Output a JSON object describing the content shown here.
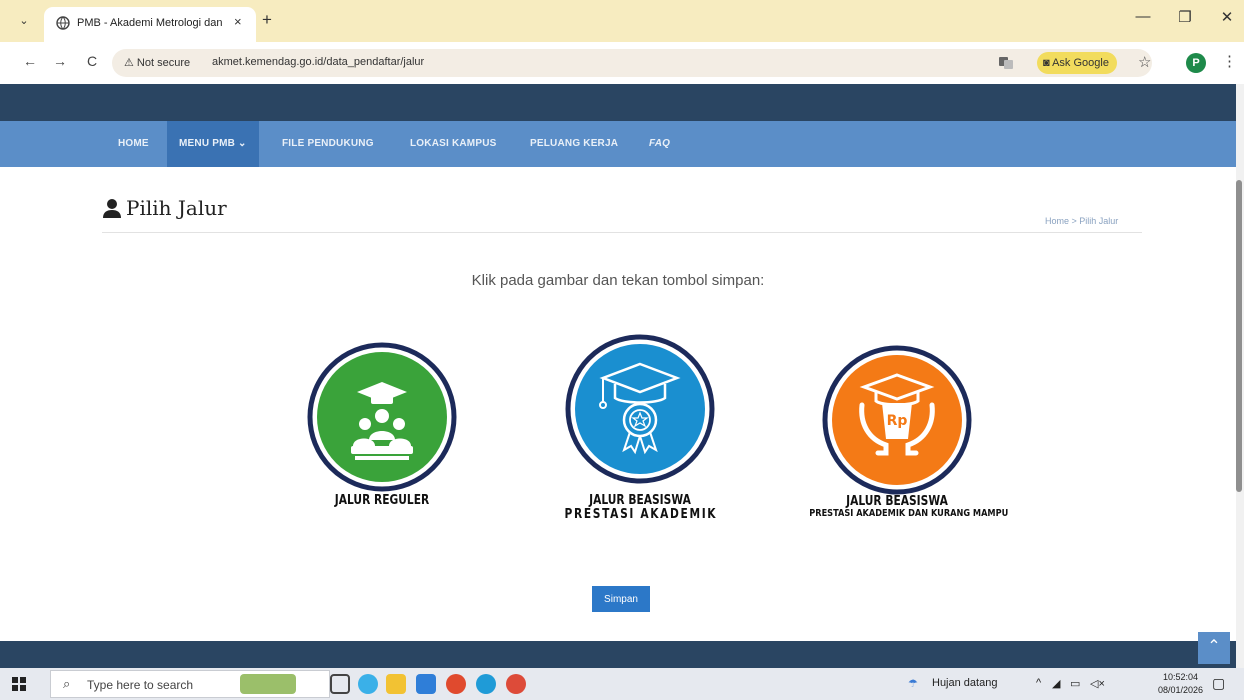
{
  "browser": {
    "tab_title": "PMB - Akademi Metrologi dan",
    "tab_close": "×",
    "new_tab": "+",
    "tab_menu": "⌄",
    "minimize": "—",
    "restore": "❐",
    "close": "✕",
    "back": "←",
    "forward": "→",
    "reload": "C",
    "security_label": "Not secure",
    "url": "akmet.kemendag.go.id/data_pendaftar/jalur",
    "ask_google": "Ask Google",
    "star": "☆",
    "profile_initial": "P",
    "menu": "⋮"
  },
  "nav": {
    "items": [
      {
        "label": "HOME"
      },
      {
        "label": "MENU PMB ⌄"
      },
      {
        "label": "FILE PENDUKUNG"
      },
      {
        "label": "LOKASI KAMPUS"
      },
      {
        "label": "PELUANG KERJA"
      },
      {
        "label": "FAQ"
      }
    ]
  },
  "page": {
    "title": "Pilih Jalur",
    "breadcrumb": "Home > Pilih Jalur",
    "instruction": "Klik pada gambar dan tekan tombol simpan:",
    "options": [
      {
        "line1": "JALUR REGULER",
        "line2": "",
        "color": "#3aa33a"
      },
      {
        "line1": "JALUR BEASISWA",
        "line2": "PRESTASI AKADEMIK",
        "color": "#1a8fd0"
      },
      {
        "line1": "JALUR BEASISWA",
        "line2": "PRESTASI AKADEMIK DAN KURANG MAMPU",
        "color": "#f47a16"
      }
    ],
    "rp_text": "Rp",
    "save_label": "Simpan",
    "back_to_top": "⌃"
  },
  "taskbar": {
    "search_placeholder": "Type here to search",
    "weather": "Hujan datang",
    "time": "10:52:04",
    "date": "08/01/2026"
  },
  "colors": {
    "top_band": "#2a4562",
    "navbar": "#5b8ec8",
    "nav_active": "#3a72b3",
    "save_button": "#2c78c8",
    "emblem_ring": "#1c2a5a"
  }
}
